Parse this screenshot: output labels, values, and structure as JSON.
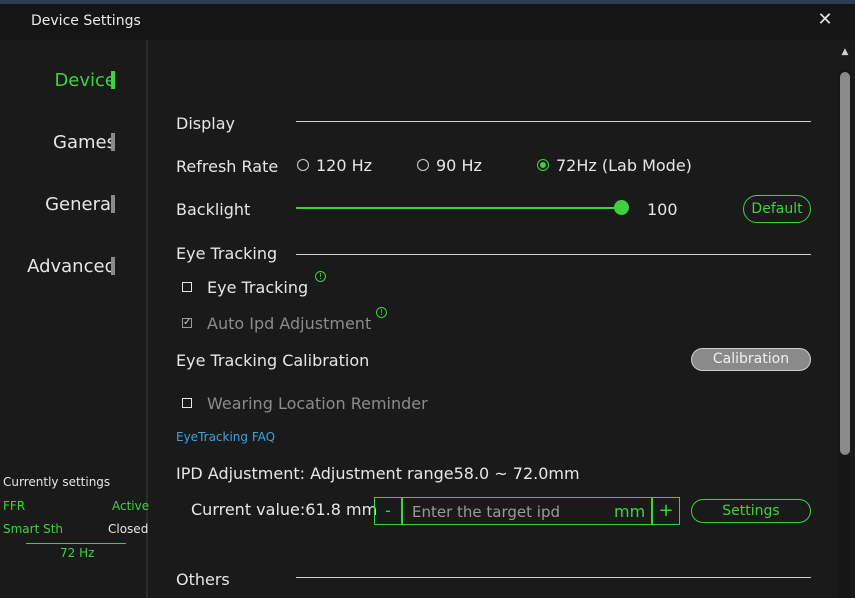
{
  "window": {
    "title": "Device Settings"
  },
  "sidebar": {
    "items": [
      {
        "label": "Device"
      },
      {
        "label": "Games"
      },
      {
        "label": "General"
      },
      {
        "label": "Advanced"
      }
    ],
    "current_settings": {
      "title": "Currently settings",
      "ffr_label": "FFR",
      "ffr_value": "Active",
      "smooth_label": "Smart Sth",
      "smooth_value": "Closed",
      "refresh": "72 Hz"
    }
  },
  "display": {
    "section_title": "Display",
    "refresh_rate_label": "Refresh Rate",
    "refresh_options": [
      "120 Hz",
      "90 Hz",
      "72Hz (Lab Mode)"
    ],
    "refresh_selected": "72Hz (Lab Mode)",
    "backlight_label": "Backlight",
    "backlight_value": "100",
    "default_label": "Default"
  },
  "eye_tracking": {
    "section_title": "Eye Tracking",
    "eye_tracking_label": "Eye Tracking",
    "auto_ipd_label": "Auto Ipd Adjustment",
    "calibration_label": "Eye Tracking Calibration",
    "calibration_button": "Calibration",
    "wearing_reminder_label": "Wearing Location Reminder",
    "faq_link": "EyeTracking FAQ"
  },
  "ipd": {
    "title": "IPD Adjustment: Adjustment range58.0 ~ 72.0mm",
    "current_value": "Current value:61.8 mm",
    "minus": "-",
    "plus": "+",
    "placeholder": "Enter the target ipd",
    "unit": "mm",
    "settings_button": "Settings"
  },
  "others": {
    "section_title": "Others"
  },
  "colors": {
    "accent": "#3fd23f",
    "link": "#3aa5e0",
    "background": "#1a1a1a"
  }
}
